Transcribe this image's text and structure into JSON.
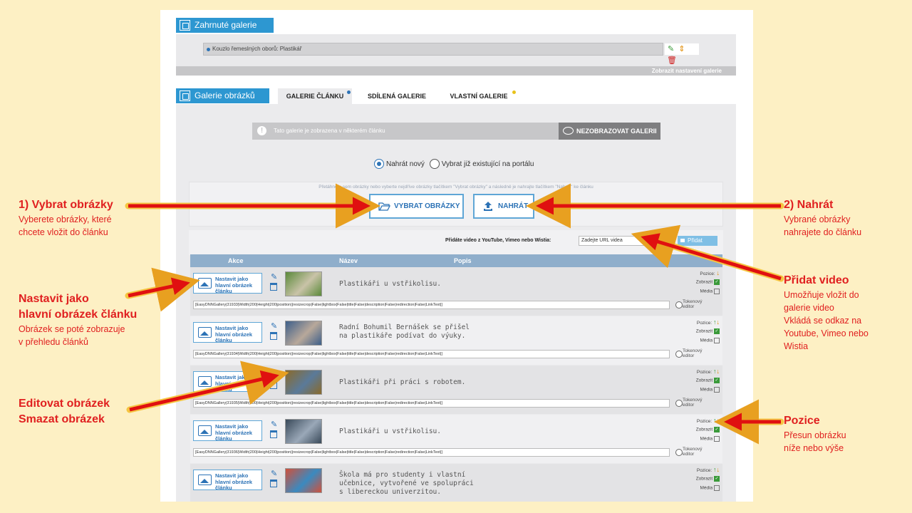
{
  "included": {
    "header": "Zahrnuté galerie",
    "item": "Kouzlo řemeslných oborů: Plastikář",
    "show_settings": "Zobrazit nastavení galerie"
  },
  "gallery": {
    "header": "Galerie obrázků",
    "tabs": [
      {
        "label": "GALERIE ČLÁNKU",
        "active": true,
        "dot": "#2d73b6"
      },
      {
        "label": "SDÍLENÁ GALERIE",
        "active": false
      },
      {
        "label": "VLASTNÍ GALERIE",
        "active": false,
        "dot": "#e8c21a"
      }
    ],
    "notice": "Tato galerie je zobrazena v některém článku",
    "notice_icon": "!",
    "hide_button": "NEZOBRAZOVAT GALERII",
    "radio_new": "Nahrát nový",
    "radio_existing": "Vybrat již existující na portálu",
    "drag_hint": "Přetáhněte sem obrázky nebo vyberte nejdříve obrázky tlačítkem \"Vybrat obrázky\" a následně je nahrajte tlačítkem \"Nahrát\" ke článku",
    "select_button": "VYBRAT OBRÁZKY",
    "upload_button": "NAHRÁT",
    "video_label": "Přidáte video z YouTube, Vimeo nebo Wistia:",
    "video_placeholder": "Zadejte URL videa",
    "video_button": "Přidat video",
    "columns": {
      "akce": "Akce",
      "nazev": "Název",
      "popis": "Popis"
    },
    "set_main_label": "Nastavit jako\nhlavní obrázek\nčlánku",
    "token_editor": "Tokenový\neditor",
    "labels": {
      "pozice": "Pozice:",
      "zobrazit": "Zobrazit",
      "media": "Média"
    },
    "rows": [
      {
        "desc": "Plastikáři u vstřikolisu.",
        "token": "[EasyDNNGallery|31933|Width|200|Height|200|position||resizecrop|False|lightbox|False|title|False|description|False|redirection|False|LinkText|]",
        "up": false,
        "down": true
      },
      {
        "desc": "Radní Bohumil Bernášek se přišel\nna plastikáře podívat do výuky.",
        "token": "[EasyDNNGallery|31934|Width|200|Height|200|position||resizecrop|False|lightbox|False|title|False|description|False|redirection|False|LinkText|]",
        "up": true,
        "down": true
      },
      {
        "desc": "Plastikáři při práci s robotem.",
        "token": "[EasyDNNGallery|31935|Width|200|Height|200|position||resizecrop|False|lightbox|False|title|False|description|False|redirection|False|LinkText|]",
        "up": true,
        "down": true
      },
      {
        "desc": "Plastikáři u vstřikolisu.",
        "token": "[EasyDNNGallery|31936|Width|200|Height|200|position||resizecrop|False|lightbox|False|title|False|description|False|redirection|False|LinkText|]",
        "up": true,
        "down": true
      },
      {
        "desc": "Škola má pro studenty i vlastní\nučebnice, vytvořené ve spolupráci\ns libereckou univerzitou.",
        "token": "",
        "up": true,
        "down": true
      }
    ]
  },
  "annotations": {
    "select_title": "1) Vybrat obrázky",
    "select_desc": "Vyberete obrázky, které\nchcete vložit do článku",
    "upload_title": "2) Nahrát",
    "upload_desc": "Vybrané obrázky\nnahrajete do článku",
    "main_title": "Nastavit jako\nhlavní obrázek článku",
    "main_desc": "Obrázek se poté zobrazuje\nv přehledu článků",
    "video_title": "Přidat video",
    "video_desc": "Umožňuje vložit do\ngalerie video\nVkládá se odkaz na\nYoutube, Vimeo nebo\nWistia",
    "edit_title": "Editovat obrázek\nSmazat obrázek",
    "position_title": "Pozice",
    "position_desc": "Přesun obrázku\nníže nebo výše"
  },
  "colors": {
    "accent": "#2d97d1",
    "annotation": "#e02020",
    "background": "#fdf0c4"
  }
}
